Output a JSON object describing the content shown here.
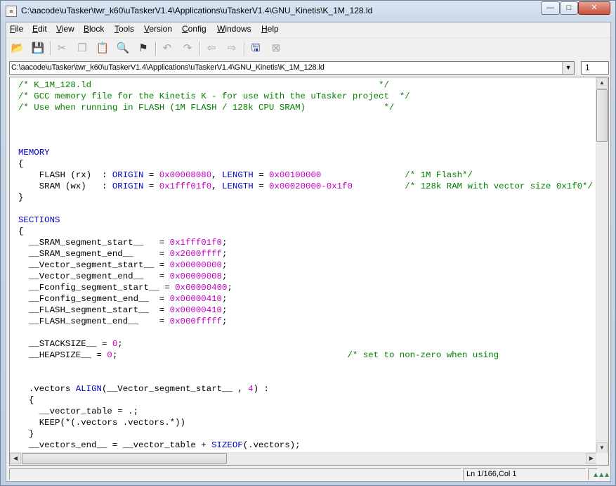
{
  "window": {
    "title": "C:\\aacode\\uTasker\\twr_k60\\uTaskerV1.4\\Applications\\uTaskerV1.4\\GNU_Kinetis\\K_1M_128.ld",
    "controls": {
      "minimize": "—",
      "maximize": "□",
      "close": "✕"
    }
  },
  "menu": [
    {
      "label": "File",
      "ul": "F",
      "rest": "ile"
    },
    {
      "label": "Edit",
      "ul": "E",
      "rest": "dit"
    },
    {
      "label": "View",
      "ul": "V",
      "rest": "iew"
    },
    {
      "label": "Block",
      "ul": "B",
      "rest": "lock"
    },
    {
      "label": "Tools",
      "ul": "T",
      "rest": "ools"
    },
    {
      "label": "Version",
      "ul": "V",
      "rest": "ersion"
    },
    {
      "label": "Config",
      "ul": "C",
      "rest": "onfig"
    },
    {
      "label": "Windows",
      "ul": "W",
      "rest": "indows"
    },
    {
      "label": "Help",
      "ul": "H",
      "rest": "elp"
    }
  ],
  "toolbar": {
    "icons": [
      "open-folder-icon",
      "save-icon",
      "cut-icon",
      "copy-icon",
      "paste-icon",
      "find-icon",
      "find-next-icon",
      "undo-icon",
      "redo-icon",
      "back-icon",
      "forward-icon",
      "save-all-icon",
      "close-file-icon"
    ],
    "glyphs": {
      "open": "📂",
      "save": "💾",
      "cut": "✂",
      "copy": "❐",
      "paste": "📋",
      "find": "🔍",
      "findnext": "⚑",
      "undo": "↶",
      "redo": "↷",
      "back": "⇦",
      "forward": "⇨",
      "saveall": "🖫",
      "close": "⊠"
    }
  },
  "pathbar": {
    "path": "C:\\aacode\\uTasker\\twr_k60\\uTaskerV1.4\\Applications\\uTaskerV1.4\\GNU_Kinetis\\K_1M_128.ld",
    "arrow": "▼",
    "line_number": "1"
  },
  "code_lines": [
    [
      [
        "cm",
        "/* K_1M_128.ld                                                       */"
      ]
    ],
    [
      [
        "cm",
        "/* GCC memory file for the Kinetis K - for use with the uTasker project  */"
      ]
    ],
    [
      [
        "cm",
        "/* Use when running in FLASH (1M FLASH / 128k CPU SRAM)               */"
      ]
    ],
    [],
    [],
    [],
    [
      [
        "kw",
        "MEMORY"
      ]
    ],
    [
      [
        "t",
        "{"
      ]
    ],
    [
      [
        "t",
        "    FLASH (rx)  : "
      ],
      [
        "kw",
        "ORIGIN"
      ],
      [
        "t",
        " = "
      ],
      [
        "num",
        "0x00008080"
      ],
      [
        "t",
        ", "
      ],
      [
        "kw",
        "LENGTH"
      ],
      [
        "t",
        " = "
      ],
      [
        "num",
        "0x00100000"
      ],
      [
        "t",
        "                "
      ],
      [
        "cm",
        "/* 1M Flash*/"
      ]
    ],
    [
      [
        "t",
        "    SRAM (wx)   : "
      ],
      [
        "kw",
        "ORIGIN"
      ],
      [
        "t",
        " = "
      ],
      [
        "num",
        "0x1fff01f0"
      ],
      [
        "t",
        ", "
      ],
      [
        "kw",
        "LENGTH"
      ],
      [
        "t",
        " = "
      ],
      [
        "num",
        "0x00020000-0x1f0"
      ],
      [
        "t",
        "          "
      ],
      [
        "cm",
        "/* 128k RAM with vector size 0x1f0*/"
      ]
    ],
    [
      [
        "t",
        "}"
      ]
    ],
    [],
    [
      [
        "kw",
        "SECTIONS"
      ]
    ],
    [
      [
        "t",
        "{"
      ]
    ],
    [
      [
        "t",
        "  __SRAM_segment_start__   = "
      ],
      [
        "num",
        "0x1fff01f0"
      ],
      [
        "t",
        ";"
      ]
    ],
    [
      [
        "t",
        "  __SRAM_segment_end__     = "
      ],
      [
        "num",
        "0x2000ffff"
      ],
      [
        "t",
        ";"
      ]
    ],
    [
      [
        "t",
        "  __Vector_segment_start__ = "
      ],
      [
        "num",
        "0x00000000"
      ],
      [
        "t",
        ";"
      ]
    ],
    [
      [
        "t",
        "  __Vector_segment_end__   = "
      ],
      [
        "num",
        "0x00000008"
      ],
      [
        "t",
        ";"
      ]
    ],
    [
      [
        "t",
        "  __Fconfig_segment_start__ = "
      ],
      [
        "num",
        "0x00000400"
      ],
      [
        "t",
        ";"
      ]
    ],
    [
      [
        "t",
        "  __Fconfig_segment_end__  = "
      ],
      [
        "num",
        "0x00000410"
      ],
      [
        "t",
        ";"
      ]
    ],
    [
      [
        "t",
        "  __FLASH_segment_start__  = "
      ],
      [
        "num",
        "0x00000410"
      ],
      [
        "t",
        ";"
      ]
    ],
    [
      [
        "t",
        "  __FLASH_segment_end__    = "
      ],
      [
        "num",
        "0x000fffff"
      ],
      [
        "t",
        ";"
      ]
    ],
    [],
    [
      [
        "t",
        "  __STACKSIZE__ = "
      ],
      [
        "num",
        "0"
      ],
      [
        "t",
        ";"
      ]
    ],
    [
      [
        "t",
        "  __HEAPSIZE__ = "
      ],
      [
        "num",
        "0"
      ],
      [
        "t",
        ";"
      ],
      [
        "t",
        "                                            "
      ],
      [
        "cm",
        "/* set to non-zero when using"
      ]
    ],
    [],
    [],
    [
      [
        "t",
        "  .vectors "
      ],
      [
        "kw",
        "ALIGN"
      ],
      [
        "t",
        "(__Vector_segment_start__ , "
      ],
      [
        "num",
        "4"
      ],
      [
        "t",
        ") :"
      ]
    ],
    [
      [
        "t",
        "  {"
      ]
    ],
    [
      [
        "t",
        "    __vector_table = .;"
      ]
    ],
    [
      [
        "t",
        "    KEEP(*(.vectors .vectors.*))"
      ]
    ],
    [
      [
        "t",
        "  }"
      ]
    ],
    [
      [
        "t",
        "  __vectors_end__ = __vector_table + "
      ],
      [
        "kw",
        "SIZEOF"
      ],
      [
        "t",
        "(.vectors);"
      ]
    ]
  ],
  "scrollbar": {
    "up": "▲",
    "down": "▼",
    "left": "◀",
    "right": "▶"
  },
  "status": {
    "position": "Ln 1/166,Col 1",
    "grip": "▲▲▲"
  }
}
